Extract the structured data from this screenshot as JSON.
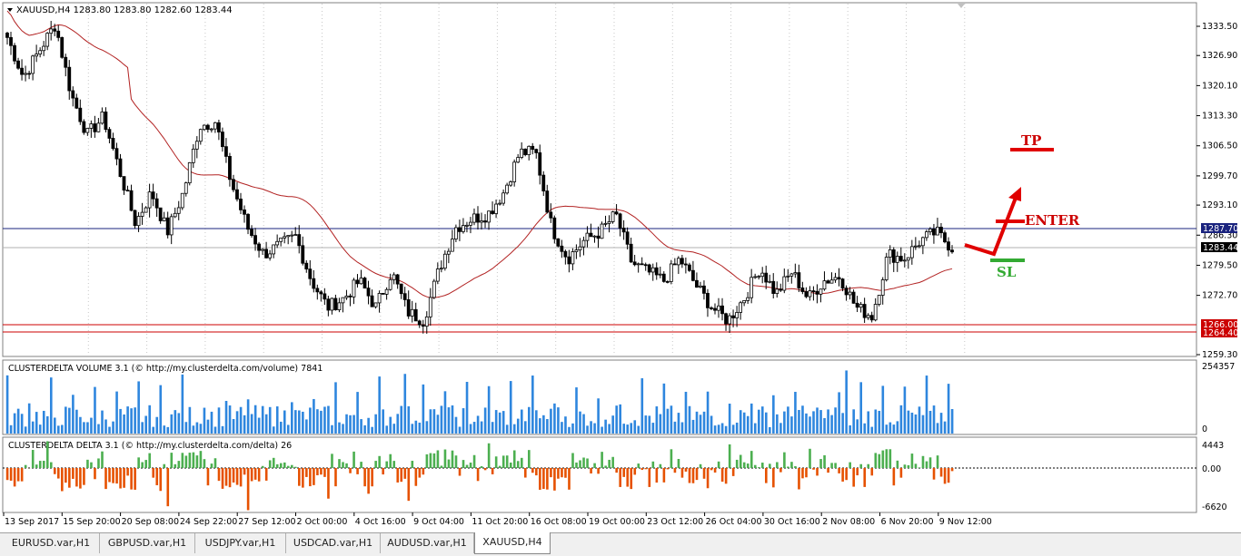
{
  "chart_header": {
    "symbol_line": "XAUUSD,H4  1283.80 1283.80 1282.60 1283.44"
  },
  "price_axis": {
    "ticks": [
      "1333.50",
      "1326.90",
      "1320.10",
      "1313.30",
      "1306.50",
      "1299.70",
      "1293.10",
      "1286.30",
      "1279.50",
      "1272.70",
      "1259.30"
    ],
    "highlighted_labels": {
      "blue_line": "1287.70",
      "current_price": "1283.44",
      "support_upper": "1266.00",
      "support_lower": "1264.40"
    }
  },
  "annotations": {
    "tp_label": "TP",
    "enter_label": "ENTER",
    "sl_label": "SL"
  },
  "volume_panel": {
    "title": "CLUSTERDELTA VOLUME 3.1 (© http://my.clusterdelta.com/volume) 7841",
    "axis_top": "254357",
    "axis_bottom": "0"
  },
  "delta_panel": {
    "title": "CLUSTERDELTA DELTA 3.1 (© http://my.clusterdelta.com/delta) 26",
    "axis_top": "4443",
    "axis_mid": "0.00",
    "axis_bottom": "-6620"
  },
  "time_axis": {
    "labels": [
      "13 Sep 2017",
      "15 Sep 20:00",
      "20 Sep 08:00",
      "24 Sep 22:00",
      "27 Sep 12:00",
      "2 Oct 00:00",
      "4 Oct 16:00",
      "9 Oct 04:00",
      "11 Oct 20:00",
      "16 Oct 08:00",
      "19 Oct 00:00",
      "23 Oct 12:00",
      "26 Oct 04:00",
      "30 Oct 16:00",
      "2 Nov 08:00",
      "6 Nov 20:00",
      "9 Nov 12:00"
    ]
  },
  "tabs": [
    {
      "label": "EURUSD.var,H1"
    },
    {
      "label": "GBPUSD.var,H1"
    },
    {
      "label": "USDJPY.var,H1"
    },
    {
      "label": "USDCAD.var,H1"
    },
    {
      "label": "AUDUSD.var,H1"
    },
    {
      "label": "XAUUSD,H4"
    }
  ],
  "colors": {
    "candle": "#000000",
    "moving_average": "#b22222",
    "resistance_line": "#1a237e",
    "support_line": "#cc0000",
    "volume_bar": "#2e86de",
    "delta_positive": "#4caf50",
    "delta_negative": "#e65100",
    "annotation_red": "#e00000",
    "annotation_green": "#33aa33"
  },
  "chart_data": {
    "type": "candlestick",
    "close_series_approx": [
      1331,
      1322,
      1328,
      1334,
      1318,
      1309,
      1313,
      1301,
      1289,
      1296,
      1287,
      1296,
      1311,
      1312,
      1298,
      1288,
      1282,
      1284,
      1286,
      1276,
      1270,
      1272,
      1276,
      1270,
      1278,
      1269,
      1267,
      1279,
      1288,
      1290,
      1291,
      1296,
      1305,
      1305,
      1288,
      1281,
      1285,
      1287,
      1291,
      1280,
      1278,
      1276,
      1281,
      1275,
      1270,
      1267,
      1272,
      1279,
      1273,
      1278,
      1272,
      1276,
      1277,
      1270,
      1268,
      1282,
      1281,
      1285,
      1287,
      1284
    ],
    "last_close": 1283.44
  }
}
